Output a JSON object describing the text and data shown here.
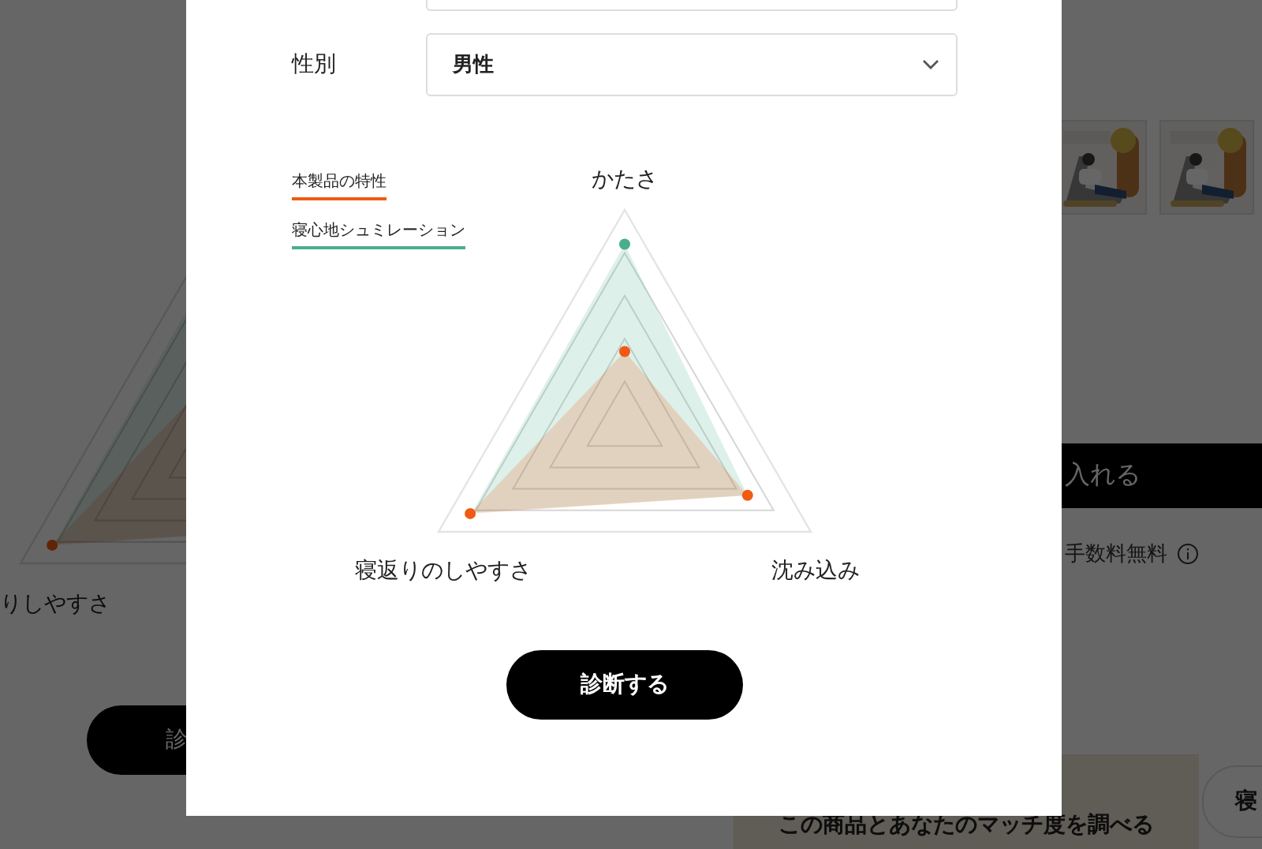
{
  "background": {
    "chart_labels": [
      "りしやすさ"
    ],
    "diagnose_button": "診",
    "cart_button": "入れる",
    "fee_note": "手数料無料",
    "match_banner": "この商品とあなたのマッチ度を調べる",
    "pill_button": "寝"
  },
  "modal": {
    "gender": {
      "label": "性別",
      "value": "男性"
    },
    "legend": [
      {
        "label": "本製品の特性",
        "color": "#f05a14"
      },
      {
        "label": "寝心地シュミレーション",
        "color": "#4aae8c"
      }
    ],
    "axes": [
      "かたさ",
      "寝返りのしやすさ",
      "沈み込み"
    ],
    "submit_button": "診断する"
  }
}
